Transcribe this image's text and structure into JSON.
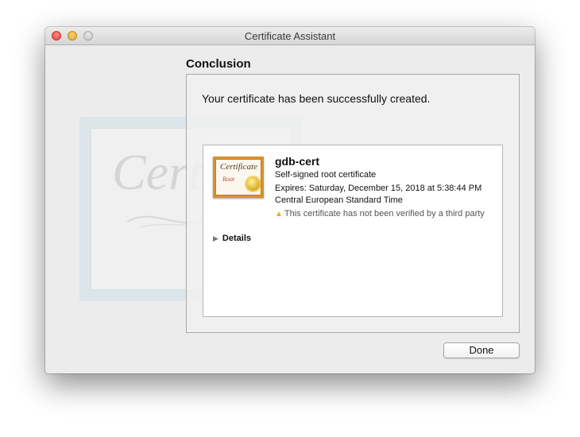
{
  "window": {
    "title": "Certificate Assistant"
  },
  "background": {
    "watermark_text": "Certif"
  },
  "page": {
    "heading": "Conclusion",
    "message": "Your certificate has been successfully created."
  },
  "certificate": {
    "icon_text": "Certificate",
    "icon_subtext": "Root",
    "name": "gdb-cert",
    "type": "Self-signed root certificate",
    "expires": "Expires: Saturday, December 15, 2018 at 5:38:44 PM Central European Standard Time",
    "warning_icon": "warning-triangle-icon",
    "warning": "This certificate has not been verified by a third party",
    "details_label": "Details"
  },
  "buttons": {
    "done_label": "Done"
  },
  "colors": {
    "close": "#e0443e",
    "minimize": "#dea236",
    "zoom": "#c4c4c4",
    "cert_frame": "#d8932e",
    "warning": "#e0b020"
  }
}
